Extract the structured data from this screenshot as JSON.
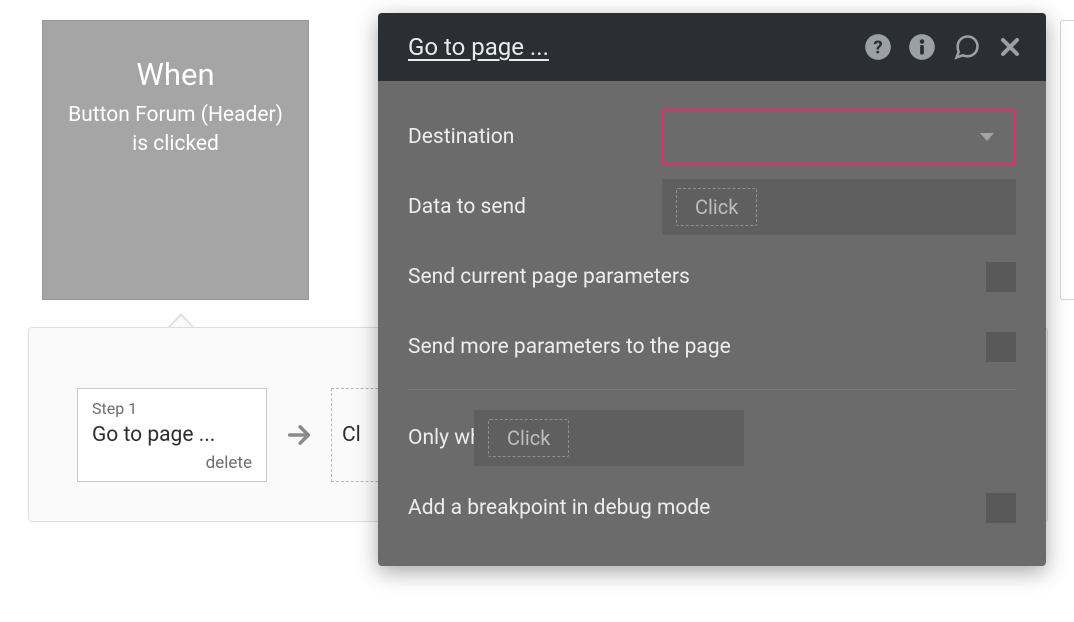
{
  "trigger": {
    "title": "When",
    "subtitle": "Button Forum (Header) is clicked"
  },
  "steps": {
    "step1": {
      "num": "Step 1",
      "action": "Go to page ...",
      "delete": "delete"
    },
    "add_hint": "Cl"
  },
  "editor": {
    "title": "Go to page ...",
    "destination_label": "Destination",
    "data_to_send_label": "Data to send",
    "data_to_send_hint": "Click",
    "send_current_params_label": "Send current page parameters",
    "send_more_params_label": "Send more parameters to the page",
    "only_when_label": "Only when",
    "only_when_hint": "Click",
    "breakpoint_label": "Add a breakpoint in debug mode"
  }
}
